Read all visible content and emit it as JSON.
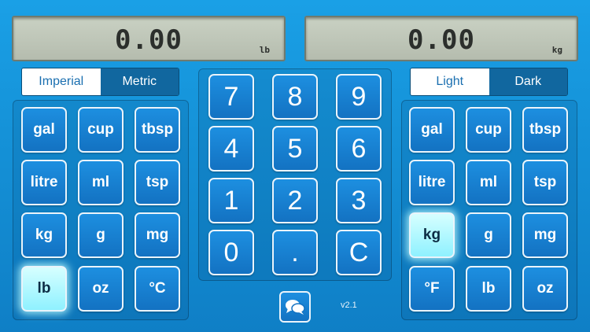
{
  "displays": {
    "left": {
      "value": "0.00",
      "unit": "lb"
    },
    "right": {
      "value": "0.00",
      "unit": "kg"
    }
  },
  "system_toggle": {
    "imperial": "Imperial",
    "metric": "Metric",
    "selected": "Imperial"
  },
  "theme_toggle": {
    "light": "Light",
    "dark": "Dark",
    "selected": "Light"
  },
  "from_units": [
    "gal",
    "cup",
    "tbsp",
    "litre",
    "ml",
    "tsp",
    "kg",
    "g",
    "mg",
    "lb",
    "oz",
    "°C"
  ],
  "from_selected": "lb",
  "to_units": [
    "gal",
    "cup",
    "tbsp",
    "litre",
    "ml",
    "tsp",
    "kg",
    "g",
    "mg",
    "°F",
    "lb",
    "oz"
  ],
  "to_selected": "kg",
  "keypad": [
    "7",
    "8",
    "9",
    "4",
    "5",
    "6",
    "1",
    "2",
    "3",
    "0",
    ".",
    "C"
  ],
  "footer": {
    "version": "v2.1",
    "chat_icon": "chat-bubbles-icon"
  },
  "colors": {
    "selected_key": "#8ff1ff",
    "lcd": "#c2c9bb",
    "background": "#1592d8"
  }
}
